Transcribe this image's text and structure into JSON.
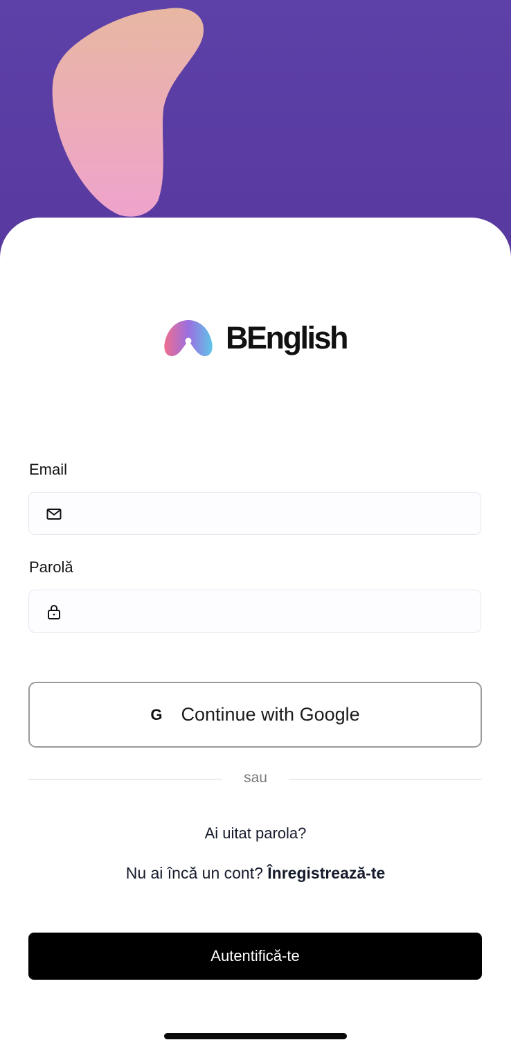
{
  "colors": {
    "hero_bg": "#5b3fa6",
    "blob_top": "#e8b6a3",
    "blob_bottom": "#eea4cc",
    "primary_button": "#000000",
    "text": "#141414"
  },
  "logo": {
    "icon": "benglish-logo-icon",
    "name": "BEnglish"
  },
  "form": {
    "email": {
      "label": "Email",
      "value": "",
      "placeholder": "",
      "icon": "mail-icon"
    },
    "password": {
      "label": "Parolă",
      "value": "",
      "placeholder": "",
      "icon": "lock-icon"
    }
  },
  "google_button": {
    "icon_glyph": "G",
    "label": "Continue with Google"
  },
  "divider_text": "sau",
  "forgot_password": "Ai uitat parola?",
  "register": {
    "prompt": "Nu ai încă un cont?",
    "link": "Înregistrează-te"
  },
  "login_button": {
    "label": "Autentifică-te"
  }
}
